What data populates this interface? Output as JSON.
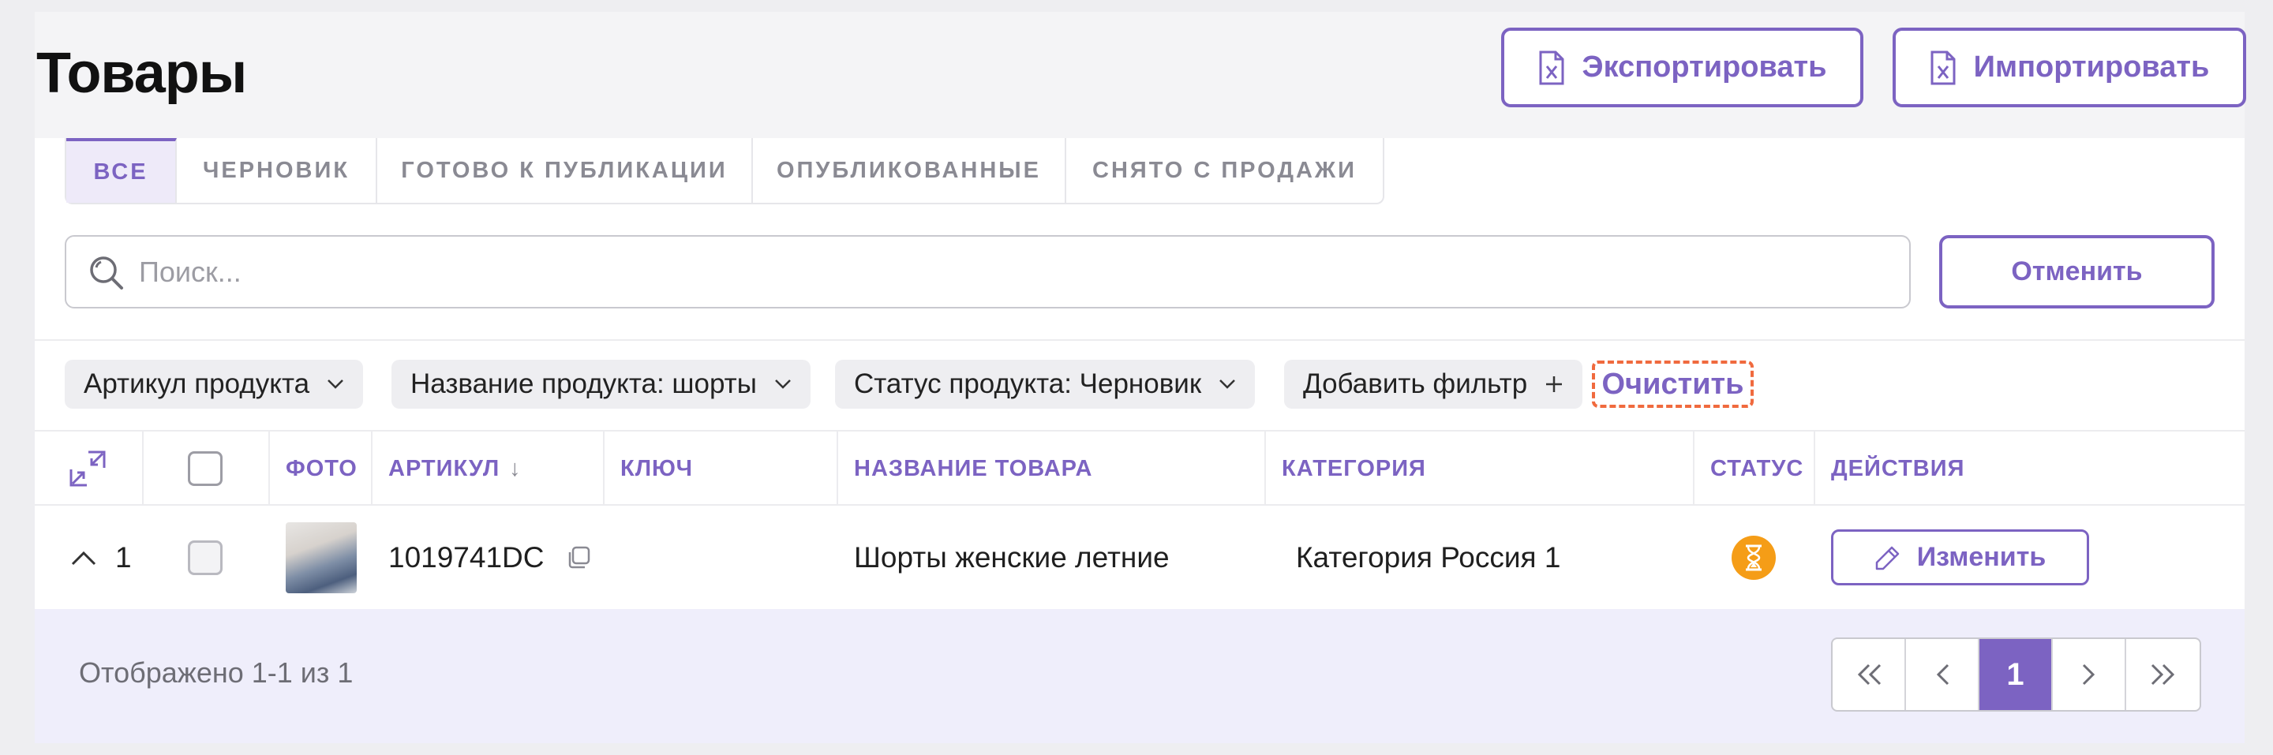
{
  "page": {
    "title": "Товары"
  },
  "actions": {
    "export_label": "Экспортировать",
    "import_label": "Импортировать"
  },
  "tabs": [
    {
      "label": "ВСЕ",
      "active": true
    },
    {
      "label": "ЧЕРНОВИК",
      "active": false
    },
    {
      "label": "ГОТОВО К ПУБЛИКАЦИИ",
      "active": false
    },
    {
      "label": "ОПУБЛИКОВАННЫЕ",
      "active": false
    },
    {
      "label": "СНЯТО С ПРОДАЖИ",
      "active": false
    }
  ],
  "search": {
    "placeholder": "Поиск...",
    "value": "",
    "cancel_label": "Отменить"
  },
  "filters": {
    "chips": [
      {
        "label": "Артикул продукта"
      },
      {
        "label": "Название продукта: шорты"
      },
      {
        "label": "Статус продукта: Черновик"
      }
    ],
    "add_label": "Добавить фильтр",
    "clear_label": "Очистить"
  },
  "table": {
    "columns": {
      "photo": "ФОТО",
      "sku": "АРТИКУЛ",
      "sku_sort": "↓",
      "key": "КЛЮЧ",
      "name": "НАЗВАНИЕ ТОВАРА",
      "category": "КАТЕГОРИЯ",
      "status": "СТАТУС",
      "actions": "ДЕЙСТВИЯ"
    },
    "rows": [
      {
        "index": "1",
        "sku": "1019741DC",
        "key": "",
        "name": "Шорты женские летние",
        "category": "Категория Россия 1",
        "status_icon": "hourglass-icon",
        "edit_label": "Изменить"
      }
    ]
  },
  "footer": {
    "summary": "Отображено 1-1 из 1"
  },
  "pagination": {
    "current_page": "1"
  },
  "colors": {
    "accent": "#7c63c2",
    "status_pending": "#f59d17",
    "clear_highlight": "#f06a3e"
  }
}
